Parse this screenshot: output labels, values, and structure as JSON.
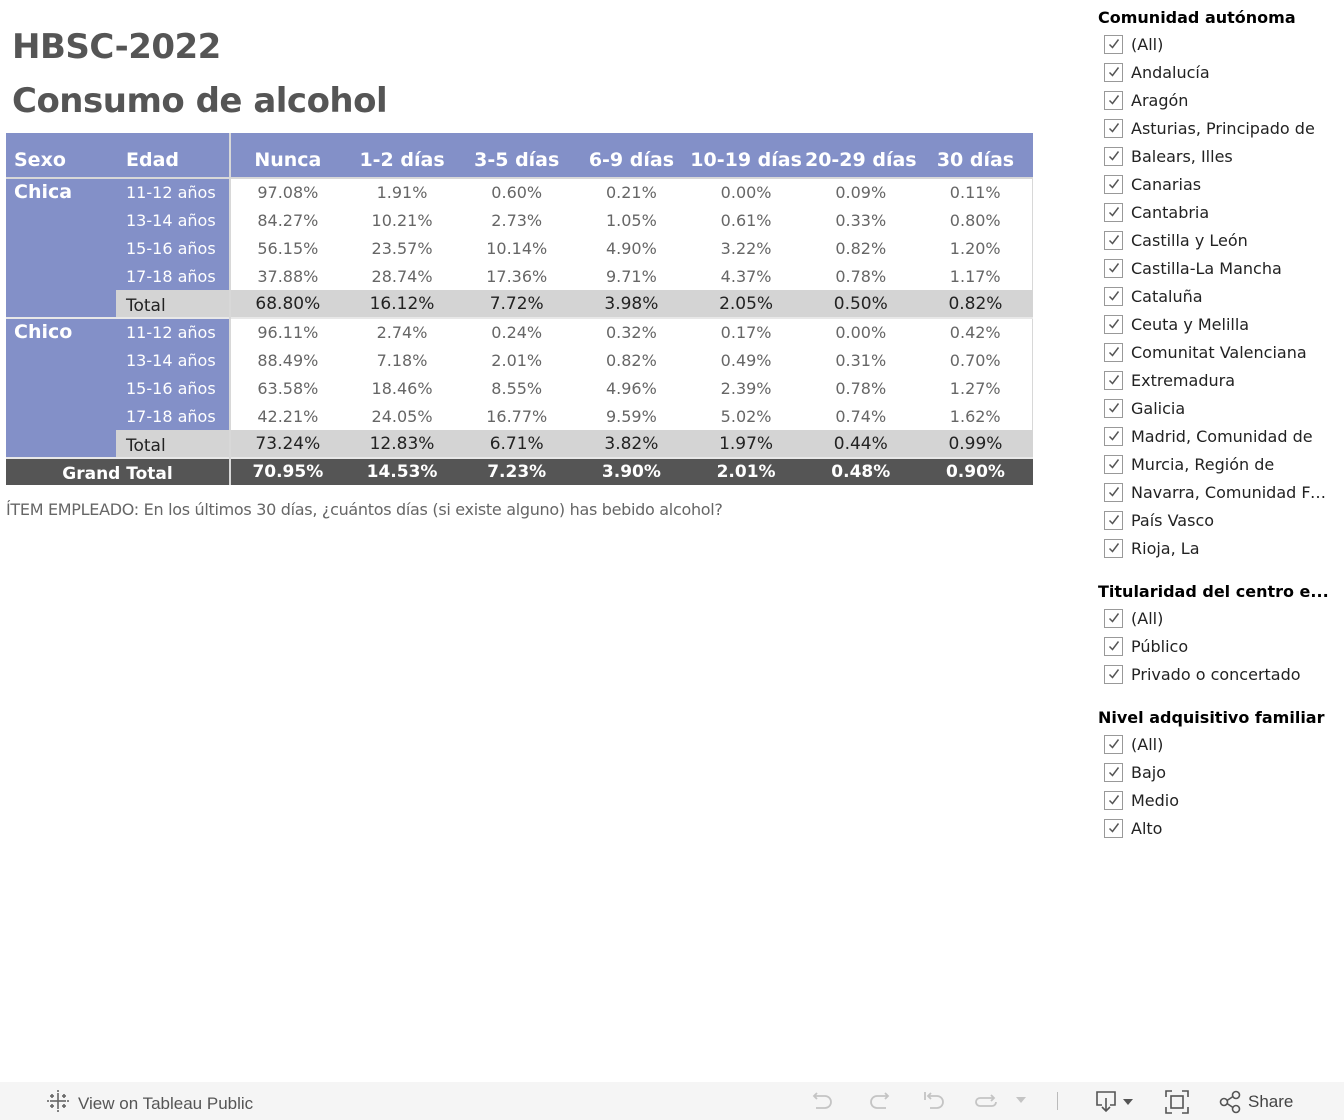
{
  "title": {
    "line1": "HBSC-2022",
    "line2": "Consumo de alcohol"
  },
  "table": {
    "headers": {
      "sexo": "Sexo",
      "edad": "Edad",
      "columns": [
        "Nunca",
        "1-2 días",
        "3-5 días",
        "6-9 días",
        "10-19 días",
        "20-29 días",
        "30 días"
      ]
    },
    "groups": [
      {
        "sexo": "Chica",
        "rows": [
          {
            "edad": "11-12 años",
            "values": [
              "97.08%",
              "1.91%",
              "0.60%",
              "0.21%",
              "0.00%",
              "0.09%",
              "0.11%"
            ]
          },
          {
            "edad": "13-14 años",
            "values": [
              "84.27%",
              "10.21%",
              "2.73%",
              "1.05%",
              "0.61%",
              "0.33%",
              "0.80%"
            ]
          },
          {
            "edad": "15-16 años",
            "values": [
              "56.15%",
              "23.57%",
              "10.14%",
              "4.90%",
              "3.22%",
              "0.82%",
              "1.20%"
            ]
          },
          {
            "edad": "17-18 años",
            "values": [
              "37.88%",
              "28.74%",
              "17.36%",
              "9.71%",
              "4.37%",
              "0.78%",
              "1.17%"
            ]
          }
        ],
        "total": {
          "label": "Total",
          "values": [
            "68.80%",
            "16.12%",
            "7.72%",
            "3.98%",
            "2.05%",
            "0.50%",
            "0.82%"
          ]
        }
      },
      {
        "sexo": "Chico",
        "rows": [
          {
            "edad": "11-12 años",
            "values": [
              "96.11%",
              "2.74%",
              "0.24%",
              "0.32%",
              "0.17%",
              "0.00%",
              "0.42%"
            ]
          },
          {
            "edad": "13-14 años",
            "values": [
              "88.49%",
              "7.18%",
              "2.01%",
              "0.82%",
              "0.49%",
              "0.31%",
              "0.70%"
            ]
          },
          {
            "edad": "15-16 años",
            "values": [
              "63.58%",
              "18.46%",
              "8.55%",
              "4.96%",
              "2.39%",
              "0.78%",
              "1.27%"
            ]
          },
          {
            "edad": "17-18 años",
            "values": [
              "42.21%",
              "24.05%",
              "16.77%",
              "9.59%",
              "5.02%",
              "0.74%",
              "1.62%"
            ]
          }
        ],
        "total": {
          "label": "Total",
          "values": [
            "73.24%",
            "12.83%",
            "6.71%",
            "3.82%",
            "1.97%",
            "0.44%",
            "0.99%"
          ]
        }
      }
    ],
    "grand_total": {
      "label": "Grand Total",
      "values": [
        "70.95%",
        "14.53%",
        "7.23%",
        "3.90%",
        "2.01%",
        "0.48%",
        "0.90%"
      ]
    }
  },
  "note": "ÍTEM EMPLEADO: En los últimos 30 días, ¿cuántos días (si existe alguno) has bebido alcohol?",
  "filters": [
    {
      "title": "Comunidad autónoma",
      "items": [
        {
          "label": "(All)",
          "checked": true
        },
        {
          "label": "Andalucía",
          "checked": true
        },
        {
          "label": "Aragón",
          "checked": true
        },
        {
          "label": "Asturias, Principado de",
          "checked": true
        },
        {
          "label": "Balears, Illes",
          "checked": true
        },
        {
          "label": "Canarias",
          "checked": true
        },
        {
          "label": "Cantabria",
          "checked": true
        },
        {
          "label": "Castilla y León",
          "checked": true
        },
        {
          "label": "Castilla-La Mancha",
          "checked": true
        },
        {
          "label": "Cataluña",
          "checked": true
        },
        {
          "label": "Ceuta y Melilla",
          "checked": true
        },
        {
          "label": "Comunitat Valenciana",
          "checked": true
        },
        {
          "label": "Extremadura",
          "checked": true
        },
        {
          "label": "Galicia",
          "checked": true
        },
        {
          "label": "Madrid, Comunidad de",
          "checked": true
        },
        {
          "label": "Murcia, Región de",
          "checked": true
        },
        {
          "label": "Navarra, Comunidad Fo...",
          "checked": true
        },
        {
          "label": "País Vasco",
          "checked": true
        },
        {
          "label": "Rioja, La",
          "checked": true
        }
      ]
    },
    {
      "title": "Titularidad del centro e...",
      "items": [
        {
          "label": "(All)",
          "checked": true
        },
        {
          "label": "Público",
          "checked": true
        },
        {
          "label": "Privado o concertado",
          "checked": true
        }
      ]
    },
    {
      "title": "Nivel adquisitivo familiar",
      "items": [
        {
          "label": "(All)",
          "checked": true
        },
        {
          "label": "Bajo",
          "checked": true
        },
        {
          "label": "Medio",
          "checked": true
        },
        {
          "label": "Alto",
          "checked": true
        }
      ]
    }
  ],
  "toolbar": {
    "view_on_tableau": "View on Tableau Public",
    "share": "Share",
    "icons": [
      "tableau-logo-icon",
      "undo-icon",
      "redo-icon",
      "revert-icon",
      "refresh-icon",
      "dropdown-icon",
      "download-icon",
      "fullscreen-icon",
      "share-icon"
    ]
  },
  "colors": {
    "header_bg": "#8390c8",
    "total_bg": "#d4d4d4",
    "grand_total_bg": "#555555",
    "title_text": "#555555"
  }
}
